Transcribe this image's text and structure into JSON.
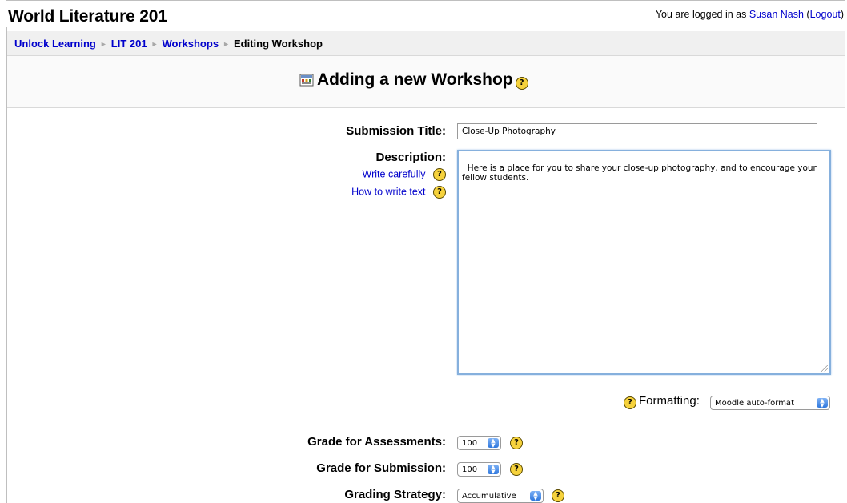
{
  "header": {
    "course_title": "World Literature 201",
    "login_prefix": "You are logged in as ",
    "user_name": "Susan Nash",
    "logout_label": "Logout"
  },
  "breadcrumb": {
    "items": [
      {
        "label": "Unlock Learning"
      },
      {
        "label": "LIT 201"
      },
      {
        "label": "Workshops"
      },
      {
        "label": "Editing Workshop"
      }
    ]
  },
  "page": {
    "heading": "Adding a new Workshop"
  },
  "form": {
    "submission_title_label": "Submission Title:",
    "submission_title_value": "Close-Up Photography",
    "description_label": "Description:",
    "write_carefully_link": "Write carefully",
    "how_to_write_link": "How to write text",
    "description_value": "Here is a place for you to share your close-up photography, and to encourage your fellow students.",
    "formatting_label": "Formatting:",
    "formatting_value": "Moodle auto-format",
    "grade_assessments_label": "Grade for Assessments:",
    "grade_assessments_value": "100",
    "grade_submission_label": "Grade for Submission:",
    "grade_submission_value": "100",
    "grading_strategy_label": "Grading Strategy:",
    "grading_strategy_value": "Accumulative"
  },
  "icons": {
    "help": "?",
    "breadcrumb_separator": "►",
    "select_arrows": "▲▼"
  }
}
